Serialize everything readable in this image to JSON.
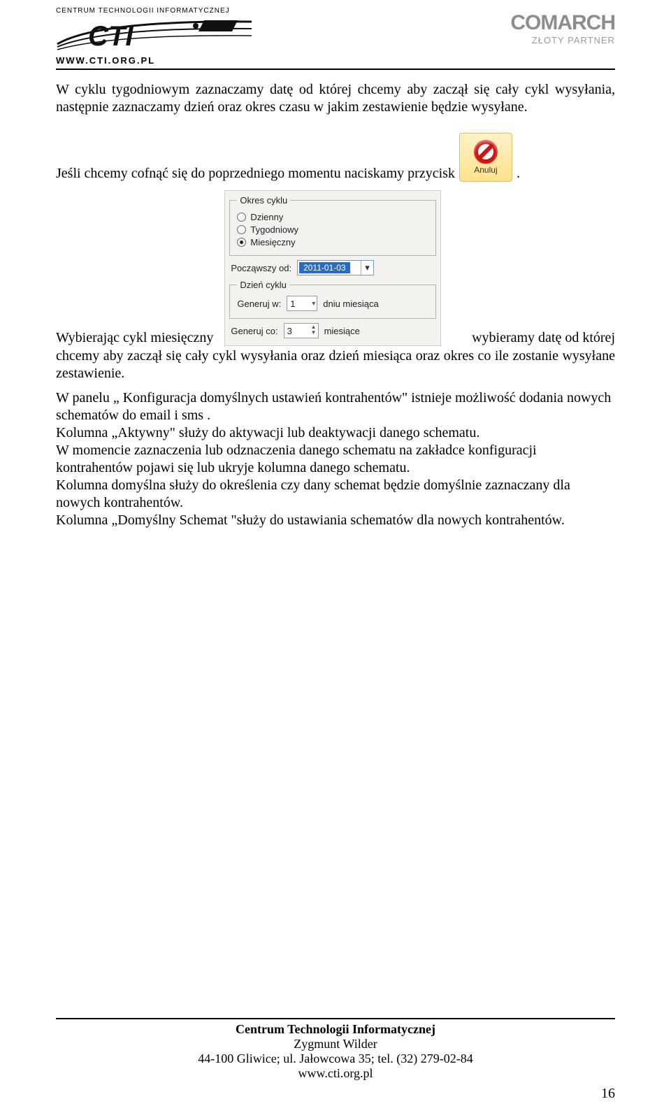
{
  "header": {
    "cti_topline": "CENTRUM TECHNOLOGII INFORMATYCZNEJ",
    "cti_url": "WWW.CTI.ORG.PL",
    "comarch_line1": "COMARCH",
    "comarch_line2": "ZŁOTY PARTNER"
  },
  "body": {
    "para1": "W cyklu tygodniowym   zaznaczamy datę od której chcemy aby zaczął się cały cykl wysyłania, następnie zaznaczamy dzień oraz okres czasu w jakim zestawienie będzie wysyłane.",
    "para2_prefix": "Jeśli chcemy cofnąć się do poprzedniego momentu naciskamy przycisk ",
    "para2_suffix": ".",
    "anuluj_label": "Anuluj",
    "para3_left": "Wybierając cykl miesięczny",
    "para3_right": "wybieramy datę od której",
    "para3_cont": "chcemy aby zaczął się cały cykl wysyłania oraz dzień miesiąca oraz okres co ile zostanie wysyłane zestawienie.",
    "para4": " W panelu „ Konfiguracja domyślnych ustawień kontrahentów\" istnieje możliwość dodania nowych schematów do email i sms .\nKolumna „Aktywny\" służy do aktywacji lub deaktywacji danego schematu.\nW momencie zaznaczenia lub odznaczenia danego schematu na zakładce konfiguracji kontrahentów pojawi się lub ukryje kolumna danego schematu.\nKolumna domyślna służy do określenia czy dany schemat będzie domyślnie zaznaczany dla nowych kontrahentów.\nKolumna „Domyślny Schemat \"służy do ustawiania schematów dla nowych kontrahentów."
  },
  "panel": {
    "okres_legend": "Okres cyklu",
    "r1": "Dzienny",
    "r2": "Tygodniowy",
    "r3": "Miesięczny",
    "poczawszy_label": "Począwszy od:",
    "date_value": "2011-01-03",
    "dzien_legend": "Dzień cyklu",
    "generuj_w": "Generuj w:",
    "generuj_w_val": "1",
    "dniu_mies": "dniu miesiąca",
    "generuj_co": "Generuj co:",
    "generuj_co_val": "3",
    "miesiace": "miesiące"
  },
  "footer": {
    "line1": "Centrum Technologii Informatycznej",
    "line2": "Zygmunt Wilder",
    "line3": "44-100 Gliwice; ul. Jałowcowa 35; tel. (32) 279-02-84",
    "line4": "www.cti.org.pl",
    "page": "16"
  }
}
